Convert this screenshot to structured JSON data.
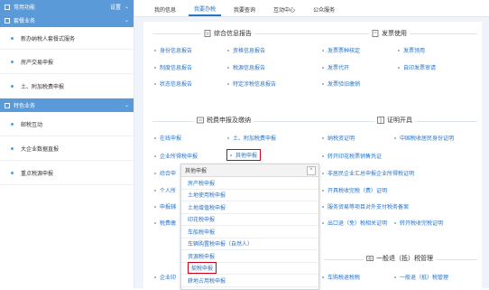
{
  "sidebar": {
    "section1": {
      "title": "常用功能",
      "extra": "设置"
    },
    "section2": {
      "title": "套餐业务",
      "items": [
        "新办纳税人套餐式服务",
        "房产交易申报",
        "土、附加税费申报"
      ]
    },
    "section3": {
      "title": "特色业务",
      "items": [
        "邮税互动",
        "大企业数据直报",
        "重点税源申报"
      ]
    }
  },
  "topnav": {
    "tabs": [
      "我的信息",
      "我要办税",
      "我要查询",
      "互动中心",
      "公众服务"
    ]
  },
  "sections": {
    "comprehensive": {
      "title": "综合信息报告",
      "links": [
        "身份信息报告",
        "资格信息报告",
        "制度信息报告",
        "税源信息报告",
        "状态信息报告",
        "特定涉税信息报告"
      ]
    },
    "invoice": {
      "title": "发票使用",
      "links": [
        "发票票种核定",
        "发票领用",
        "发票代开",
        "自印发票审请",
        "发票验旧缴销"
      ]
    },
    "declare": {
      "title": "税费申报及缴纳",
      "links": [
        "在线申报",
        "土、附加税费申报",
        "企业所得税申报",
        "其他申报",
        "综合申",
        "个人所",
        "申报辅",
        "税费缴"
      ]
    },
    "cert": {
      "title": "证明开具",
      "links": [
        "纳税资证明",
        "中国税收居民身份证明",
        "转开印花税票销售凭证",
        "非居民企业汇总申报企业所得税证明",
        "开具税收完税（费）证明",
        "服务贸易等项目对外支付税务备案",
        "出口退（免）税相关证明",
        "转开税收完税证明"
      ]
    },
    "general": {
      "title": "一般退（抵）税管理",
      "links": [
        "企业印",
        "车购税退税税",
        "一般退（抵）税管理"
      ]
    }
  },
  "popup": {
    "title": "其他申报",
    "close": "×",
    "items": [
      "房产税申报",
      "土地使用税申报",
      "土地增值税申报",
      "印花税申报",
      "车船税申报",
      "车辆购置税申报（自然人）",
      "资源税申报",
      "契税申报",
      "耕地占用税申报"
    ]
  }
}
